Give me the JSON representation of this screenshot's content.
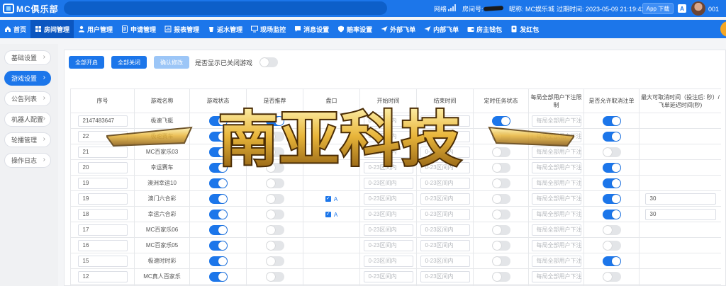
{
  "topbar": {
    "logo": "MC俱乐部",
    "network_label": "网络",
    "room_label": "房间号:",
    "nickname": "昵称: MC娱乐城",
    "expiry": "过期时间: 2023-05-09 21:19:42",
    "app_download": "App 下载",
    "a_badge": "A",
    "user_short": "001"
  },
  "nav": [
    {
      "label": "首页",
      "icon": "home-icon"
    },
    {
      "label": "房间管理",
      "icon": "grid-icon"
    },
    {
      "label": "用户管理",
      "icon": "user-icon"
    },
    {
      "label": "申请管理",
      "icon": "form-icon"
    },
    {
      "label": "报表管理",
      "icon": "report-icon"
    },
    {
      "label": "返水管理",
      "icon": "refund-icon"
    },
    {
      "label": "现场监控",
      "icon": "monitor-icon"
    },
    {
      "label": "消息设置",
      "icon": "message-icon"
    },
    {
      "label": "赔率设置",
      "icon": "shield-icon"
    },
    {
      "label": "外部飞单",
      "icon": "plane-icon"
    },
    {
      "label": "内部飞单",
      "icon": "plane-icon"
    },
    {
      "label": "房主钱包",
      "icon": "wallet-icon"
    },
    {
      "label": "发红包",
      "icon": "redpacket-icon"
    }
  ],
  "sidebar": [
    {
      "label": "基础设置"
    },
    {
      "label": "游戏设置",
      "active": true
    },
    {
      "label": "公告列表"
    },
    {
      "label": "机器人配置"
    },
    {
      "label": "轮播管理"
    },
    {
      "label": "操作日志"
    }
  ],
  "toolbar": {
    "open_all": "全部开启",
    "close_all": "全部关闭",
    "confirm": "确认修改",
    "show_closed": "是否显示已关闭游戏"
  },
  "table": {
    "headers": [
      "序号",
      "游戏名称",
      "游戏状态",
      "是否推荐",
      "盘口",
      "开始时间",
      "结束时间",
      "定时任务状态",
      "每局全部用户下注限制",
      "是否允许取消注单",
      "最大可取消时间（投注后: 秒）/飞单延迟时间(秒)"
    ],
    "time_placeholder": "0-23区间内",
    "limit_placeholder": "每局全部用户下注",
    "rows": [
      {
        "seq": "2147483647",
        "name": "极速飞艇",
        "status": true,
        "rec": true,
        "pankou": "",
        "task": true,
        "cancel": true,
        "max": ""
      },
      {
        "seq": "22",
        "name": "极速赛车",
        "status": true,
        "rec": false,
        "pankou": "",
        "task": false,
        "cancel": true,
        "max": ""
      },
      {
        "seq": "21",
        "name": "MC百家乐03",
        "status": true,
        "rec": false,
        "pankou": "",
        "task": false,
        "cancel": false,
        "max": ""
      },
      {
        "seq": "20",
        "name": "幸运赛车",
        "status": true,
        "rec": false,
        "pankou": "",
        "task": false,
        "cancel": true,
        "max": ""
      },
      {
        "seq": "19",
        "name": "澳洲幸运10",
        "status": true,
        "rec": false,
        "pankou": "",
        "task": false,
        "cancel": true,
        "max": ""
      },
      {
        "seq": "19",
        "name": "澳门六合彩",
        "status": true,
        "rec": false,
        "pankou": "A",
        "task": false,
        "cancel": true,
        "max": "30"
      },
      {
        "seq": "18",
        "name": "幸运六合彩",
        "status": true,
        "rec": false,
        "pankou": "A",
        "task": false,
        "cancel": true,
        "max": "30"
      },
      {
        "seq": "17",
        "name": "MC百家乐06",
        "status": true,
        "rec": false,
        "pankou": "",
        "task": false,
        "cancel": false,
        "max": ""
      },
      {
        "seq": "16",
        "name": "MC百家乐05",
        "status": true,
        "rec": false,
        "pankou": "",
        "task": false,
        "cancel": false,
        "max": ""
      },
      {
        "seq": "15",
        "name": "极速时时彩",
        "status": true,
        "rec": false,
        "pankou": "",
        "task": false,
        "cancel": true,
        "max": ""
      },
      {
        "seq": "12",
        "name": "MC真人百家乐",
        "status": true,
        "rec": false,
        "pankou": "",
        "task": false,
        "cancel": false,
        "max": ""
      },
      {
        "seq": "",
        "name": "",
        "status": true,
        "rec": false,
        "pankou": "",
        "task": false,
        "cancel": true,
        "max": ""
      }
    ]
  },
  "watermark": "南亚科技"
}
